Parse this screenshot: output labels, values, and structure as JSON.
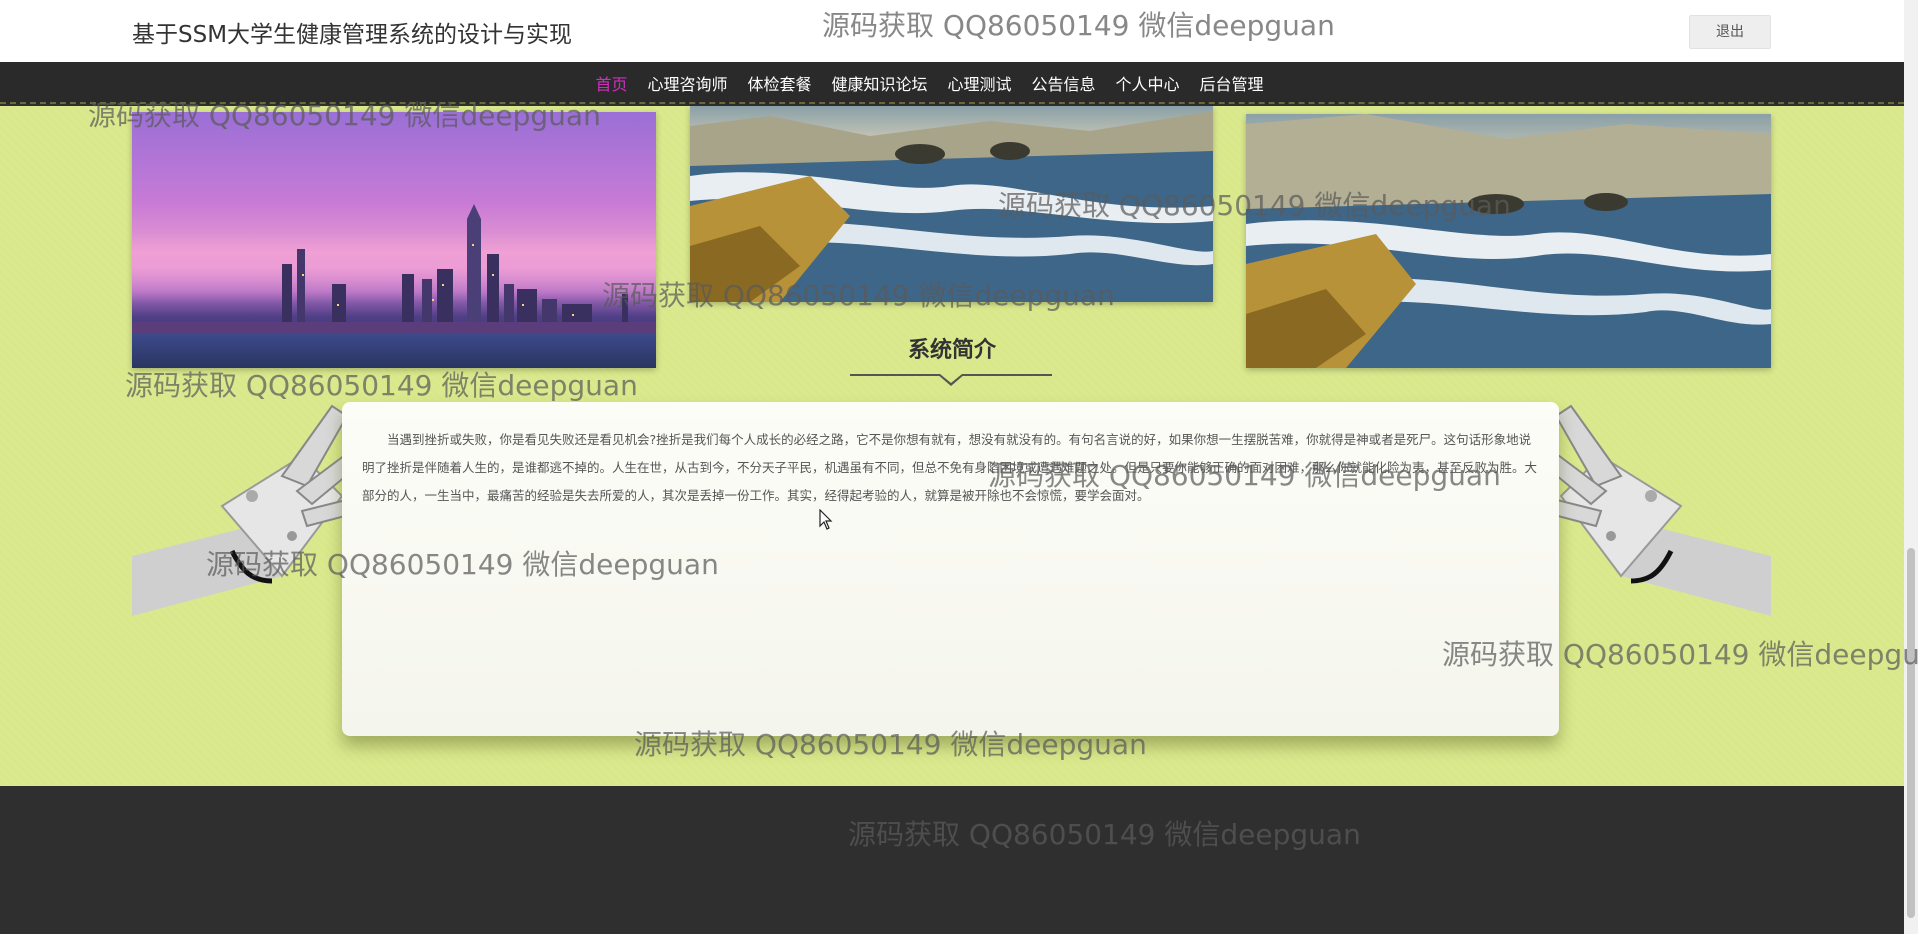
{
  "header": {
    "site_title": "基于SSM大学生健康管理系统的设计与实现",
    "logout_label": "退出"
  },
  "nav": {
    "items": [
      {
        "label": "首页",
        "active": true
      },
      {
        "label": "心理咨询师",
        "active": false
      },
      {
        "label": "体检套餐",
        "active": false
      },
      {
        "label": "健康知识论坛",
        "active": false
      },
      {
        "label": "心理测试",
        "active": false
      },
      {
        "label": "公告信息",
        "active": false
      },
      {
        "label": "个人中心",
        "active": false
      },
      {
        "label": "后台管理",
        "active": false
      }
    ]
  },
  "intro": {
    "title": "系统简介",
    "text": "当遇到挫折或失败，你是看见失败还是看见机会?挫折是我们每个人成长的必经之路，它不是你想有就有，想没有就没有的。有句名言说的好，如果你想一生摆脱苦难，你就得是神或者是死尸。这句话形象地说明了挫折是伴随着人生的，是谁都逃不掉的。人生在世，从古到今，不分天子平民，机遇虽有不同，但总不免有身陷困境或遭遇难题之处。但是只要你能够正确的面对困难，那么你就能化险为夷，甚至反败为胜。大部分的人，一生当中，最痛苦的经验是失去所爱的人，其次是丢掉一份工作。其实，经得起考验的人，就算是被开除也不会惊慌，要学会面对。"
  },
  "watermark_text": "源码获取 QQ86050149 微信deepguan",
  "colors": {
    "accent": "#d12ec0",
    "nav_bg": "#2a2a2a",
    "main_bg": "#d9e88a",
    "footer_bg": "#2f2f2f"
  },
  "icons": {
    "cursor": "mouse-pointer-icon"
  }
}
